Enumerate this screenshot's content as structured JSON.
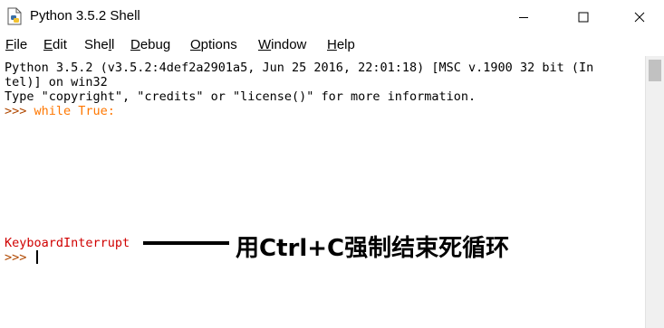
{
  "window": {
    "title": "Python 3.5.2 Shell",
    "icon": "python-idle-icon",
    "controls": [
      "minimize-icon",
      "maximize-icon",
      "close-icon"
    ]
  },
  "menu": {
    "items": [
      {
        "ul": "F",
        "rest": "ile"
      },
      {
        "ul": "E",
        "rest": "dit"
      },
      {
        "pre": "She",
        "ul": "l",
        "rest": "l"
      },
      {
        "ul": "D",
        "rest": "ebug"
      },
      {
        "ul": "O",
        "rest": "ptions"
      },
      {
        "ul": "W",
        "rest": "indow"
      },
      {
        "ul": "H",
        "rest": "elp"
      }
    ]
  },
  "shell": {
    "banner_line1": "Python 3.5.2 (v3.5.2:4def2a2901a5, Jun 25 2016, 22:01:18) [MSC v.1900 32 bit (In",
    "banner_line2": "tel)] on win32",
    "banner_line3": "Type \"copyright\", \"credits\" or \"license()\" for more information.",
    "prompt": ">>> ",
    "code": "while True:",
    "interrupt": "KeyboardInterrupt",
    "prompt2": ">>> "
  },
  "annotation": {
    "text": "用Ctrl+C强制结束死循环"
  },
  "colors": {
    "prompt": "#b04800",
    "keyword": "#ff7700",
    "error": "#d00000"
  }
}
